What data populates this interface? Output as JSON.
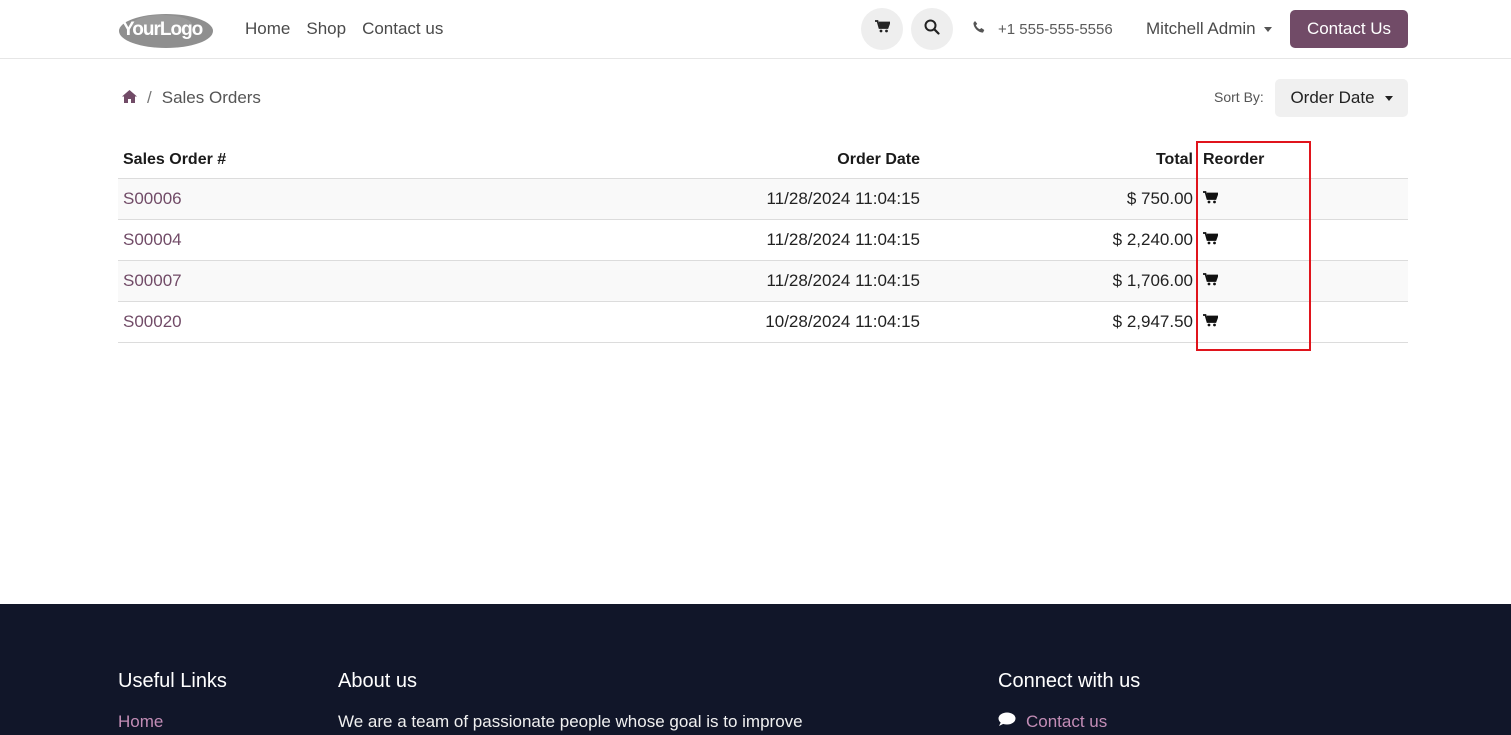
{
  "header": {
    "logo_text": "YourLogo",
    "nav": [
      "Home",
      "Shop",
      "Contact us"
    ],
    "phone": "+1 555-555-5556",
    "user": "Mitchell Admin",
    "contact_button": "Contact Us"
  },
  "breadcrumb": {
    "separator": "/",
    "current": "Sales Orders"
  },
  "sort": {
    "label": "Sort By:",
    "value": "Order Date"
  },
  "table": {
    "headers": {
      "order": "Sales Order #",
      "date": "Order Date",
      "total": "Total",
      "reorder": "Reorder"
    },
    "rows": [
      {
        "order": "S00006",
        "date": "11/28/2024  11:04:15",
        "total": "$ 750.00"
      },
      {
        "order": "S00004",
        "date": "11/28/2024  11:04:15",
        "total": "$ 2,240.00"
      },
      {
        "order": "S00007",
        "date": "11/28/2024  11:04:15",
        "total": "$ 1,706.00"
      },
      {
        "order": "S00020",
        "date": "10/28/2024  11:04:15",
        "total": "$ 2,947.50"
      }
    ]
  },
  "footer": {
    "useful_links_title": "Useful Links",
    "useful_links_first": "Home",
    "about_title": "About us",
    "about_text": "We are a team of passionate people whose goal is to improve",
    "connect_title": "Connect with us",
    "connect_first": "Contact us"
  },
  "colors": {
    "brand": "#714b67",
    "footer_bg": "#111629",
    "highlight": "#e0141c"
  },
  "icons": [
    "cart-icon",
    "search-icon",
    "phone-icon",
    "home-icon",
    "comment-icon"
  ]
}
